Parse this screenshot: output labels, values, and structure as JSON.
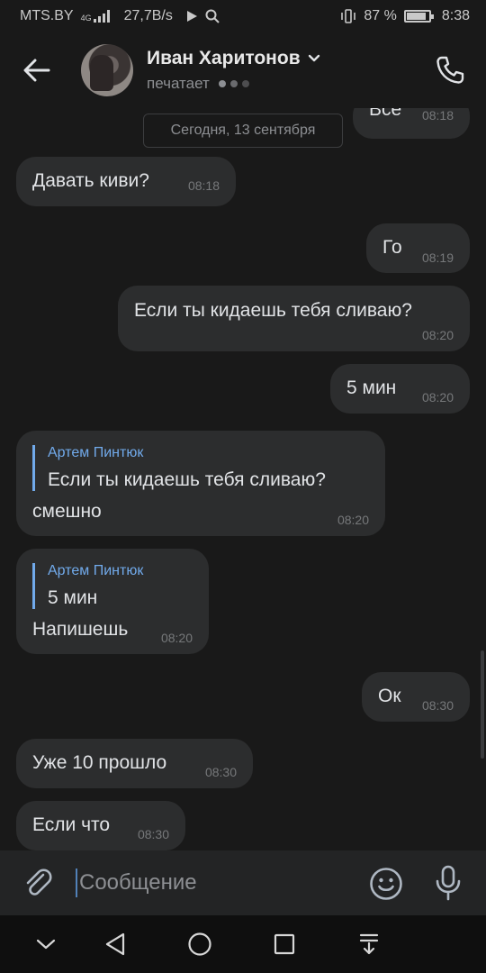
{
  "status_bar": {
    "carrier": "MTS.BY",
    "network_type": "4G",
    "speed": "27,7B/s",
    "battery_percent": "87 %",
    "battery_level": 0.87,
    "time": "8:38",
    "icons": [
      "signal-bars-icon",
      "play-icon",
      "search-icon",
      "vibrate-icon",
      "battery-icon"
    ]
  },
  "header": {
    "name": "Иван Харитонов",
    "status": "печатает",
    "icons": [
      "back-arrow-icon",
      "avatar",
      "chevron-down-icon",
      "phone-icon"
    ]
  },
  "date_divider": "Сегодня, 13 сентября",
  "messages": [
    {
      "direction": "out",
      "text": "Все",
      "time": "08:18"
    },
    {
      "direction": "in",
      "text": "Давать киви?",
      "time": "08:18"
    },
    {
      "direction": "out",
      "text": "Го",
      "time": "08:19"
    },
    {
      "direction": "out",
      "text": "Если ты кидаешь тебя сливаю?",
      "time": "08:20"
    },
    {
      "direction": "out",
      "text": "5 мин",
      "time": "08:20"
    },
    {
      "direction": "in",
      "reply_author": "Артем Пинтюк",
      "reply_text": "Если ты кидаешь тебя сливаю?",
      "text": "смешно",
      "time": "08:20"
    },
    {
      "direction": "in",
      "reply_author": "Артем Пинтюк",
      "reply_text": "5 мин",
      "text": "Напишешь",
      "time": "08:20"
    },
    {
      "direction": "out",
      "text": "Ок",
      "time": "08:30"
    },
    {
      "direction": "in",
      "text": "Уже 10 прошло",
      "time": "08:30"
    },
    {
      "direction": "in",
      "text": "Если что",
      "time": "08:30"
    }
  ],
  "composer": {
    "placeholder": "Сообщение",
    "icons": [
      "paperclip-icon",
      "emoji-icon",
      "microphone-icon"
    ]
  },
  "nav_bar": {
    "icons": [
      "chevron-down-icon",
      "back-triangle-icon",
      "home-circle-icon",
      "recents-square-icon",
      "notification-pull-icon"
    ]
  },
  "colors": {
    "background": "#191919",
    "bubble": "#2c2d2e",
    "text": "#e1e3e6",
    "secondary_text": "#8d8f93",
    "accent": "#71aaeb"
  }
}
